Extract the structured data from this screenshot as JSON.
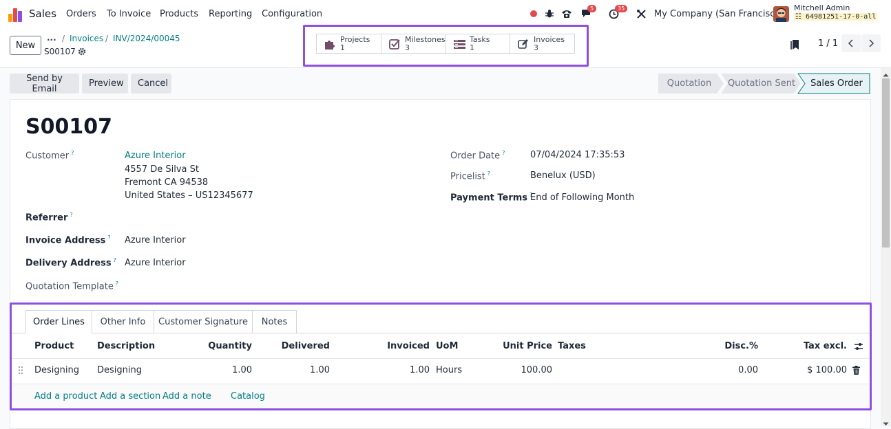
{
  "navbar": {
    "app_name": "Sales",
    "menus": [
      "Orders",
      "To Invoice",
      "Products",
      "Reporting",
      "Configuration"
    ],
    "chat_count": "5",
    "activity_count": "35",
    "company": "My Company (San Francisco)",
    "user_name": "Mitchell Admin",
    "db_name": "64981251-17-0-all"
  },
  "control": {
    "new_label": "New",
    "breadcrumb_ellipsis": "...",
    "breadcrumb_invoices": "Invoices",
    "breadcrumb_invoice": "INV/2024/00045",
    "record_name": "S00107",
    "pager": "1 / 1"
  },
  "smart_buttons": [
    {
      "label": "Projects",
      "count": "1",
      "icon": "puzzle-icon"
    },
    {
      "label": "Milestones",
      "count": "3",
      "icon": "check-square-icon"
    },
    {
      "label": "Tasks",
      "count": "1",
      "icon": "tasks-icon"
    },
    {
      "label": "Invoices",
      "count": "3",
      "icon": "edit-icon"
    }
  ],
  "actions": {
    "send": "Send by Email",
    "preview": "Preview",
    "cancel": "Cancel"
  },
  "stages": [
    "Quotation",
    "Quotation Sent",
    "Sales Order"
  ],
  "form": {
    "title": "S00107",
    "customer_label": "Customer",
    "customer_name": "Azure Interior",
    "customer_addr1": "4557 De Silva St",
    "customer_addr2": "Fremont CA 94538",
    "customer_addr3": "United States – US12345677",
    "referrer_label": "Referrer",
    "invoice_address_label": "Invoice Address",
    "invoice_address": "Azure Interior",
    "delivery_address_label": "Delivery Address",
    "delivery_address": "Azure Interior",
    "quotation_template_label": "Quotation Template",
    "order_date_label": "Order Date",
    "order_date": "07/04/2024 17:35:53",
    "pricelist_label": "Pricelist",
    "pricelist": "Benelux (USD)",
    "payment_terms_label": "Payment Terms",
    "payment_terms": "End of Following Month",
    "help_mark": "?"
  },
  "tabs": [
    "Order Lines",
    "Other Info",
    "Customer Signature",
    "Notes"
  ],
  "table": {
    "headers": {
      "product": "Product",
      "description": "Description",
      "quantity": "Quantity",
      "delivered": "Delivered",
      "invoiced": "Invoiced",
      "uom": "UoM",
      "unit_price": "Unit Price",
      "taxes": "Taxes",
      "disc": "Disc.%",
      "tax_excl": "Tax excl."
    },
    "rows": [
      {
        "product": "Designing",
        "description": "Designing",
        "quantity": "1.00",
        "delivered": "1.00",
        "invoiced": "1.00",
        "uom": "Hours",
        "unit_price": "100.00",
        "taxes": "",
        "disc": "0.00",
        "tax_excl": "$ 100.00"
      }
    ],
    "add_product": "Add a product",
    "add_section": "Add a section",
    "add_note": "Add a note",
    "catalog": "Catalog"
  },
  "colors": {
    "accent": "#017e84",
    "highlight": "#8e4ee0",
    "badge": "#e5484d"
  }
}
